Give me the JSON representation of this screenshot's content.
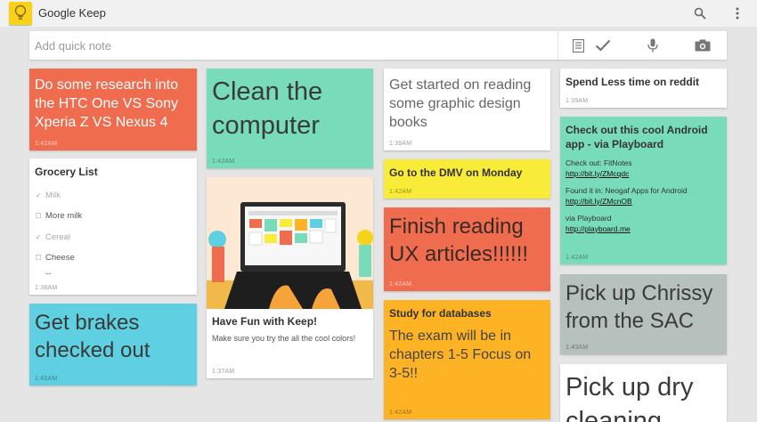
{
  "app": {
    "title": "Google Keep"
  },
  "quick_note": {
    "placeholder": "Add quick note"
  },
  "colors": {
    "red": "#f06c4f",
    "teal": "#78dcbb",
    "yellow": "#f8ec38",
    "orange": "#fdb324",
    "blue": "#5fd0e2",
    "gray": "#b6c0bd",
    "white": "#ffffff",
    "keep_yellow": "#f7d21b"
  },
  "icons": {
    "app": "lightbulb-icon",
    "search": "search-icon",
    "overflow": "overflow-menu-icon",
    "list": "list-note-icon",
    "check": "checkmark-icon",
    "mic": "microphone-icon",
    "camera": "camera-icon"
  },
  "notes": {
    "htc": {
      "text": "Do some research into the HTC One VS Sony Xperia Z VS Nexus 4",
      "time": "1:42AM"
    },
    "grocery": {
      "title": "Grocery List",
      "items": [
        {
          "text": "Milk",
          "checked": true
        },
        {
          "text": "More milk",
          "checked": false
        },
        {
          "text": "Cereal",
          "checked": true
        },
        {
          "text": "Cheese",
          "checked": false
        },
        {
          "text": "--",
          "checked": false
        }
      ],
      "time": "1:38AM"
    },
    "brakes": {
      "text": "Get brakes checked out",
      "time": "1:42AM"
    },
    "clean": {
      "text": "Clean the computer",
      "time": "1:42AM"
    },
    "keep": {
      "title": "Have Fun with Keep!",
      "body": "Make sure you try the all the cool colors!",
      "time": "1:37AM"
    },
    "graphic": {
      "text": "Get started on reading some graphic design books",
      "time": "1:39AM"
    },
    "dmv": {
      "text": "Go to the DMV on Monday",
      "time": "1:42AM"
    },
    "ux": {
      "text": "Finish reading UX articles!!!!!!",
      "time": "1:42AM"
    },
    "databases": {
      "title": "Study for databases",
      "body": "The exam will be in chapters 1-5 Focus on 3-5!!",
      "time": "1:42AM"
    },
    "reddit": {
      "text": "Spend Less time on reddit",
      "time": "1:39AM"
    },
    "android": {
      "title": "Check out this cool Android app - via Playboard",
      "line1": "Check out: FitNotes",
      "link1": "http://bit.ly/ZMcqdc",
      "line2": "Found it in: Neogaf Apps for Android",
      "link2": "http://bit.ly/ZMcnOB",
      "line3": "via Playboard",
      "link3": "http://playboard.me",
      "time": "1:42AM"
    },
    "chrissy": {
      "text": "Pick up Chrissy from the SAC",
      "time": "1:43AM"
    },
    "drycleaning": {
      "text": "Pick up dry cleaning"
    }
  }
}
